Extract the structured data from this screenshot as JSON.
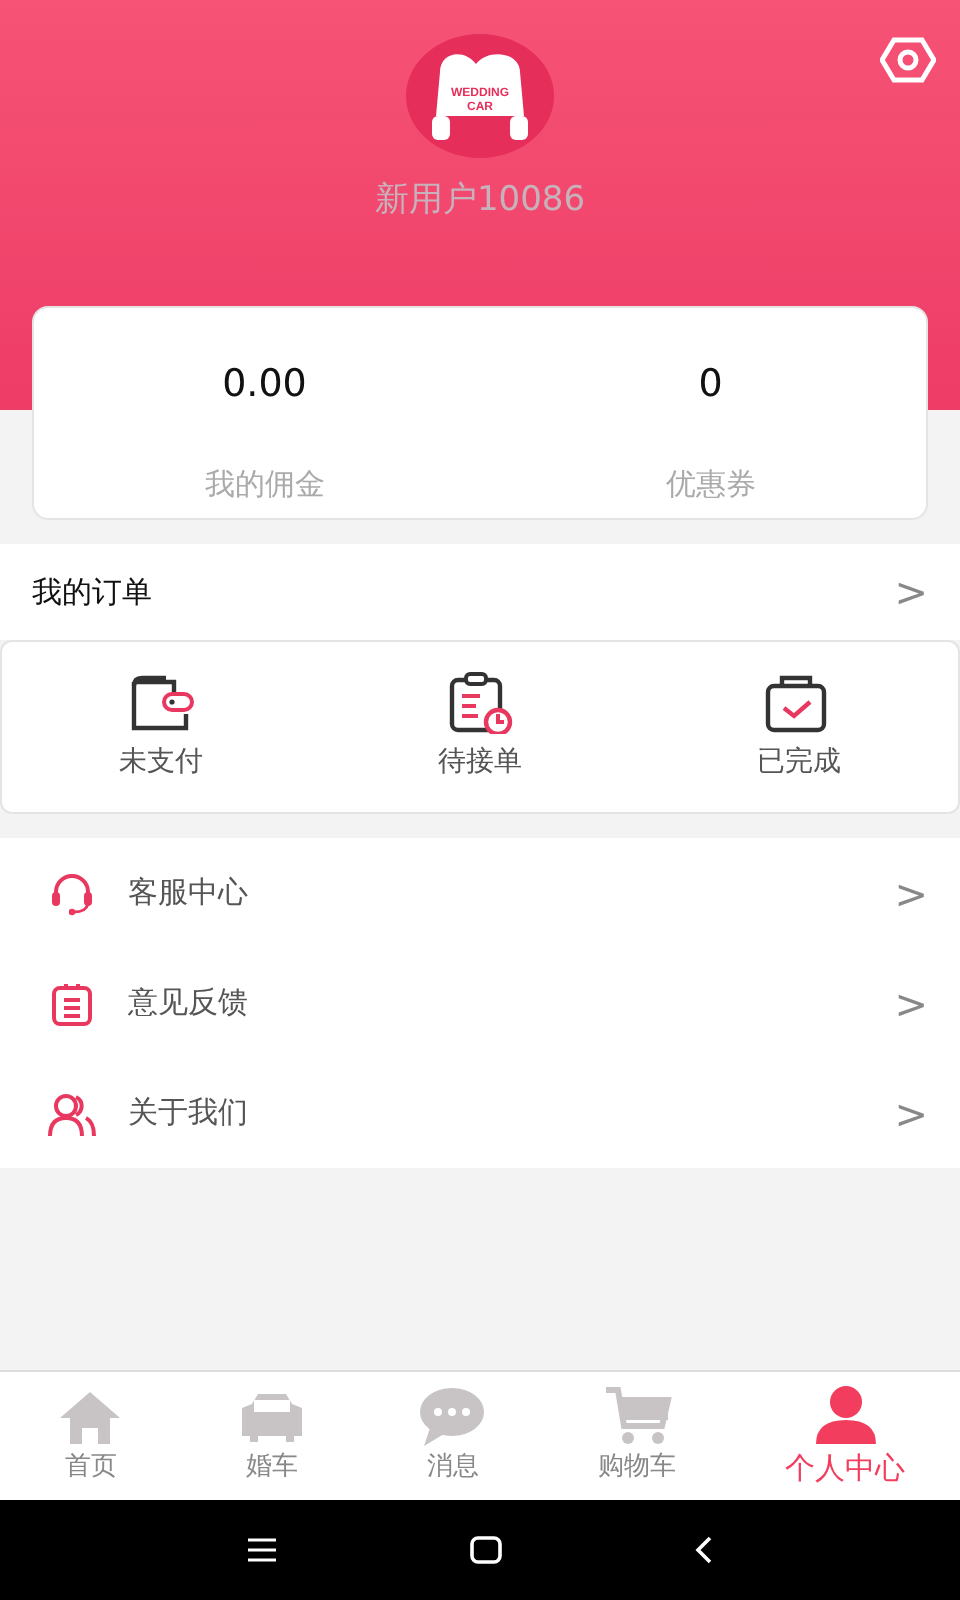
{
  "profile": {
    "logo_lines": [
      "WEDDING",
      "CAR"
    ],
    "username": "新用户10086"
  },
  "stats": [
    {
      "value": "0.00",
      "label": "我的佣金"
    },
    {
      "value": "0",
      "label": "优惠券"
    }
  ],
  "orders": {
    "title": "我的订单",
    "chevron": ">",
    "items": [
      {
        "kind": "wallet",
        "label": "未支付"
      },
      {
        "kind": "clipboard",
        "label": "待接单"
      },
      {
        "kind": "done",
        "label": "已完成"
      }
    ]
  },
  "menu": [
    {
      "kind": "headset",
      "label": "客服中心",
      "chevron": ">"
    },
    {
      "kind": "note",
      "label": "意见反馈",
      "chevron": ">"
    },
    {
      "kind": "people",
      "label": "关于我们",
      "chevron": ">"
    }
  ],
  "tabbar": [
    {
      "kind": "home",
      "label": "首页",
      "selected": false
    },
    {
      "kind": "car",
      "label": "婚车",
      "selected": false
    },
    {
      "kind": "chat",
      "label": "消息",
      "selected": false
    },
    {
      "kind": "cart",
      "label": "购物车",
      "selected": false
    },
    {
      "kind": "person",
      "label": "个人中心",
      "selected": true
    }
  ]
}
